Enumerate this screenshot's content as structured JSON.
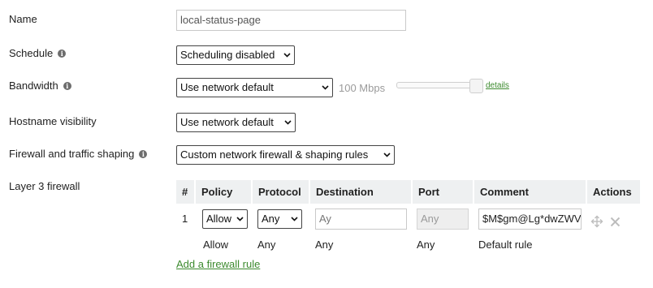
{
  "form": {
    "name": {
      "label": "Name",
      "value": "local-status-page"
    },
    "schedule": {
      "label": "Schedule",
      "value": "Scheduling disabled"
    },
    "bandwidth": {
      "label": "Bandwidth",
      "value": "Use network default",
      "limit_text": "100 Mbps",
      "details_link": "details"
    },
    "hostname": {
      "label": "Hostname visibility",
      "value": "Use network default"
    },
    "firewall": {
      "label": "Firewall and traffic shaping",
      "value": "Custom network firewall & shaping rules"
    },
    "layer3": {
      "label": "Layer 3 firewall"
    }
  },
  "icons": {
    "info": "info-icon",
    "move": "move-icon",
    "delete": "close-icon"
  },
  "colors": {
    "link": "#3c8a2e",
    "header_bg": "#eef0f1"
  },
  "table": {
    "headers": [
      "#",
      "Policy",
      "Protocol",
      "Destination",
      "Port",
      "Comment",
      "Actions"
    ],
    "rule": {
      "index": "1",
      "policy": "Allow",
      "protocol": "Any",
      "destination_placeholder": "Ay",
      "port_placeholder": "Any",
      "comment_value": "$M$gm@Lg*dwZWV"
    },
    "default_row": {
      "policy": "Allow",
      "protocol": "Any",
      "destination": "Any",
      "port": "Any",
      "comment": "Default rule"
    }
  },
  "add_rule_link": "Add a firewall rule"
}
